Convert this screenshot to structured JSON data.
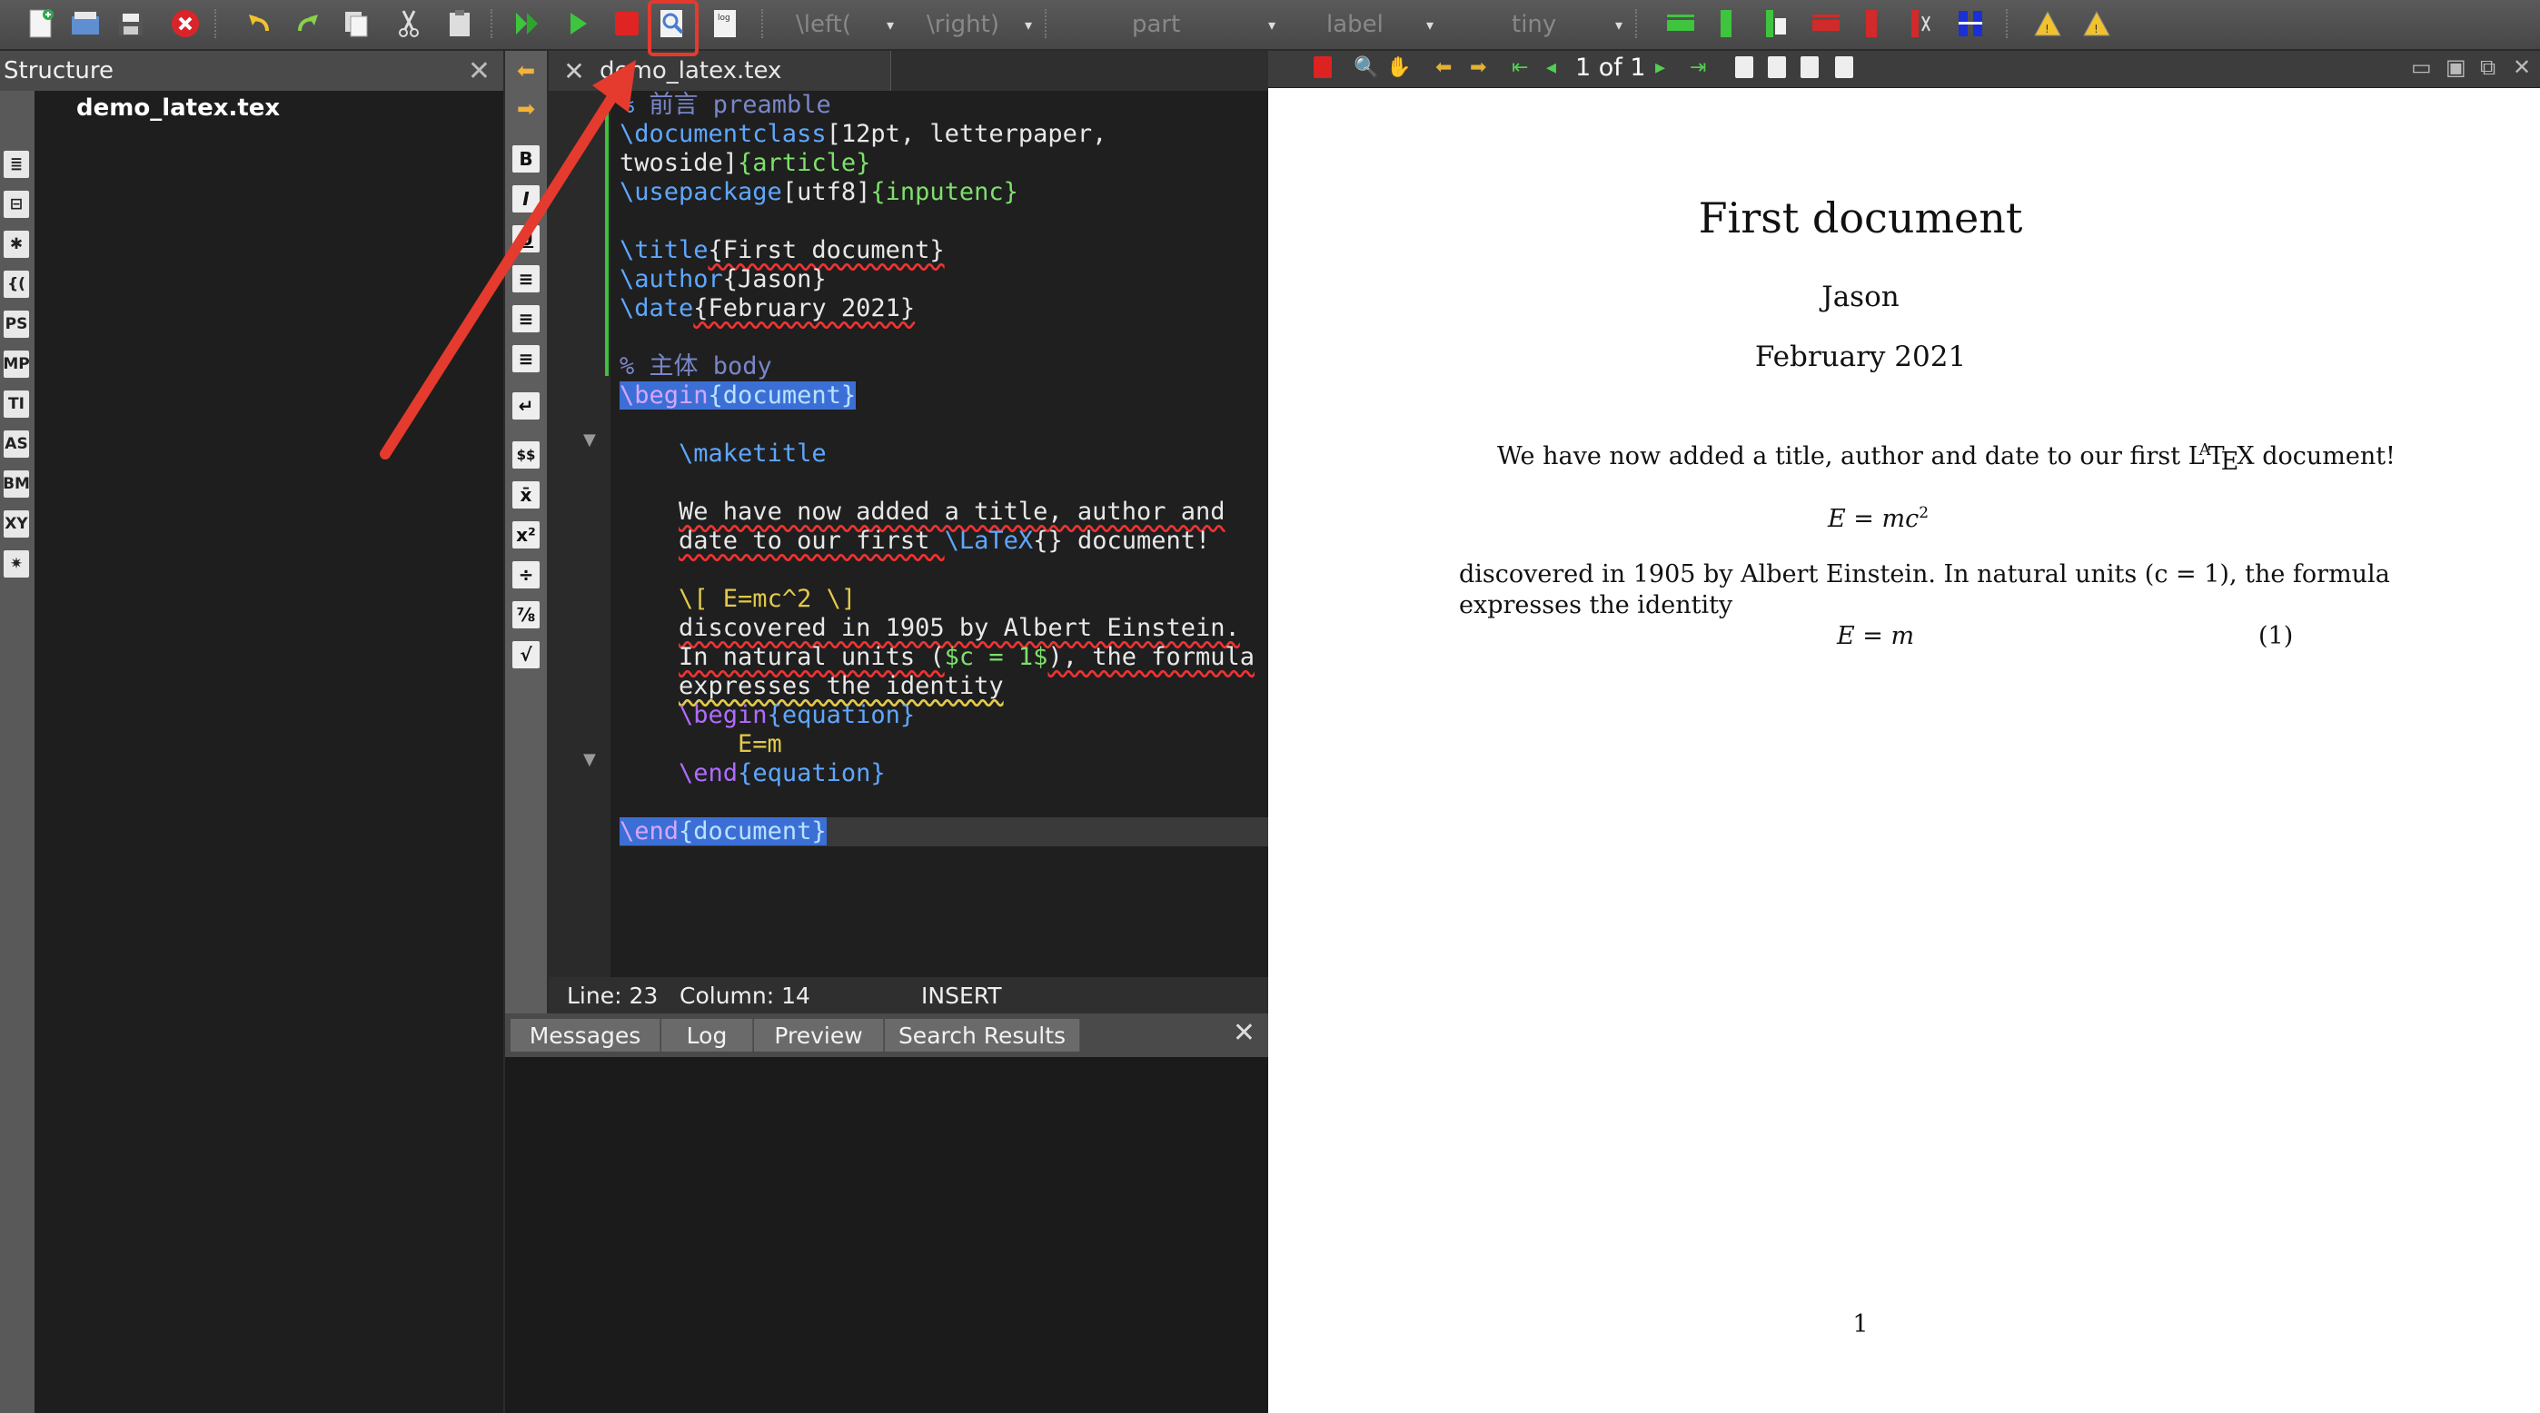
{
  "toolbar": {
    "combos": [
      {
        "label": "\\left("
      },
      {
        "label": "\\right)"
      },
      {
        "label": "part"
      },
      {
        "label": "label"
      },
      {
        "label": "tiny"
      }
    ]
  },
  "structure": {
    "title": "Structure",
    "side_tabs": [
      "≣",
      "⊟",
      "✱",
      "{(",
      "PS",
      "MP",
      "TI",
      "AS",
      "BM",
      "XY",
      "✷"
    ],
    "file": "demo_latex.tex"
  },
  "symbar": {
    "items": [
      "B",
      "I",
      "U",
      "≡",
      "≡",
      "≡",
      "↵",
      "$$",
      "x̄",
      "x²",
      "÷",
      "⅞",
      "√"
    ]
  },
  "editor": {
    "tab_label": "demo_latex.tex",
    "status": {
      "line": "Line: 23",
      "column": "Column: 14",
      "mode": "INSERT"
    }
  },
  "code": {
    "l1_pct": "% ",
    "l1_text": "前言 preamble",
    "l2_cmd": "\\documentclass",
    "l2_opt": "[12pt, letterpaper,",
    "l3_opt": "twoside]",
    "l3_arg": "{article}",
    "l4_cmd": "\\usepackage",
    "l4_opt": "[utf8]",
    "l4_arg": "{inputenc}",
    "l6_cmd": "\\title",
    "l6_arg": "{First document}",
    "l7_cmd": "\\author",
    "l7_arg": "{Jason}",
    "l8_cmd": "\\date",
    "l8_arg": "{February 2021}",
    "l10_text": "% 主体 body",
    "l11_begin": "\\begin",
    "l11_env": "{document}",
    "l13_cmd": "\\maketitle",
    "l15_text": "We have now added a title, author and",
    "l16_a": "date to our first ",
    "l16_cmd": "\\LaTeX",
    "l16_b": "{} document!",
    "l18_math": "\\[ E=mc^2 \\]",
    "l19_text": "discovered in 1905 by Albert Einstein.",
    "l20_a": "In natural units (",
    "l20_math": "$c = 1$",
    "l20_b": "), the formula",
    "l21_text": "expresses the identity",
    "l22_begin": "\\begin",
    "l22_env": "{equation}",
    "l23_math": "E=m",
    "l24_end": "\\end",
    "l24_env": "{equation}",
    "l26_end": "\\end",
    "l26_env": "{document}"
  },
  "messages": {
    "tabs": [
      "Messages",
      "Log",
      "Preview",
      "Search Results"
    ]
  },
  "viewer": {
    "page": "1",
    "of": "of 1"
  },
  "pdf": {
    "title": "First document",
    "author": "Jason",
    "date": "February 2021",
    "para1_a": "We have now added a title, author and date to our first ",
    "para1_b": " document!",
    "eq1": "E = mc",
    "eq1_sup": "2",
    "para2_line1": "discovered in 1905 by Albert Einstein. In natural units (c = 1), the formula",
    "para2_line2": "expresses the identity",
    "eq2": "E = m",
    "eq2_num": "(1)",
    "page_number": "1"
  },
  "colors": {
    "annotation_red": "#e53a2e",
    "keyword_blue": "#5ea7ff",
    "argument_green": "#7ee06b",
    "comment_purple": "#7a86c9",
    "env_purple": "#b06bff"
  }
}
